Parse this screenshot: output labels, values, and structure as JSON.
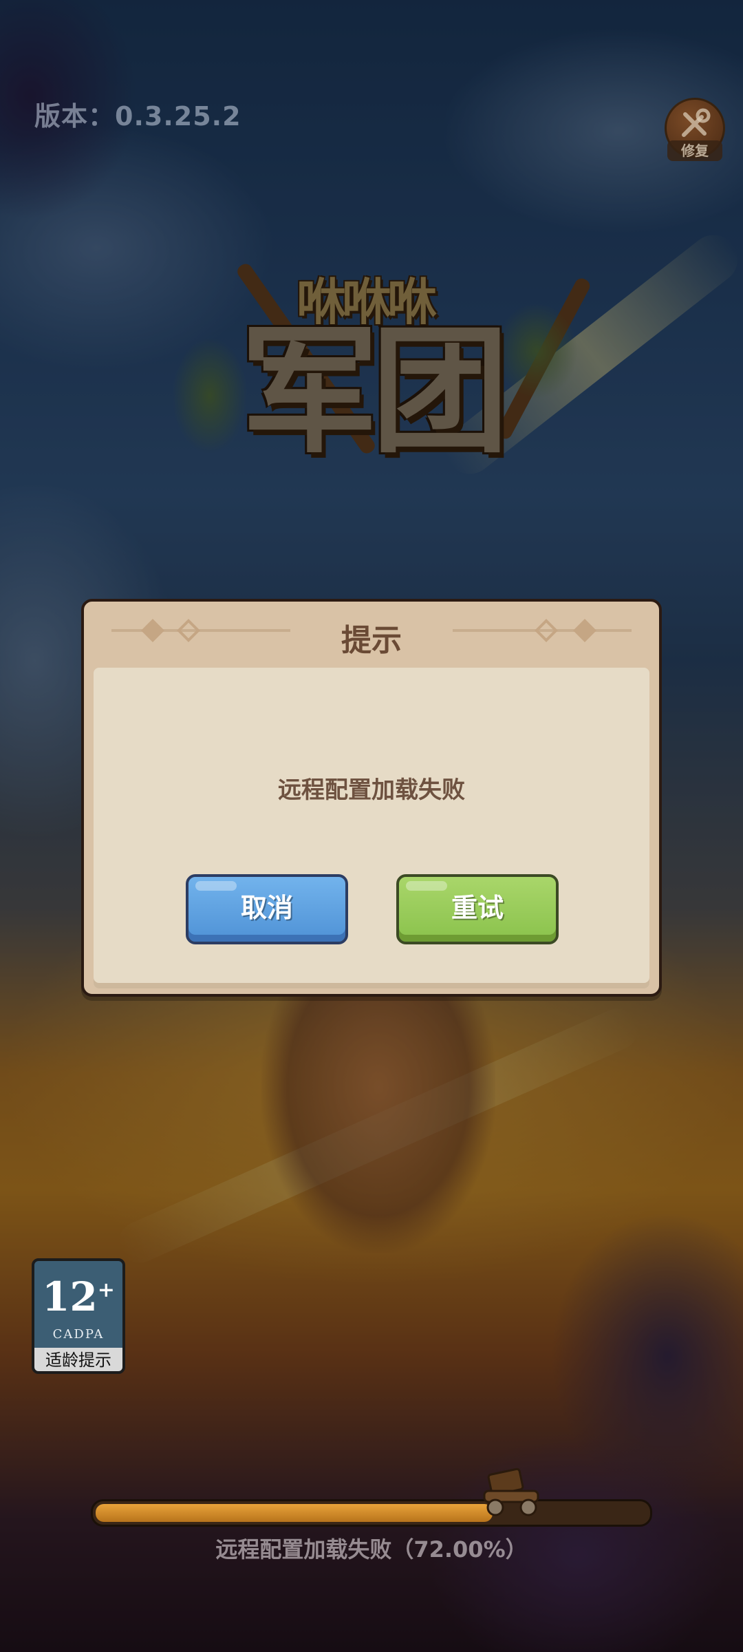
{
  "version_text": "版本：0.3.25.2",
  "repair": {
    "label": "修复",
    "icon": "wrench-screwdriver-icon"
  },
  "logo": {
    "top_text": "咻咻咻",
    "main_text": "军团"
  },
  "dialog": {
    "title": "提示",
    "message": "远程配置加载失败",
    "cancel_label": "取消",
    "retry_label": "重试"
  },
  "age_rating": {
    "number": "12",
    "plus": "+",
    "org": "CADPA",
    "tip": "适龄提示"
  },
  "progress": {
    "fraction": 0.72,
    "text": "远程配置加载失败（72.00%）"
  },
  "colors": {
    "cancel_button": "#5a9fe0",
    "retry_button": "#98cb58",
    "dialog_frame": "#d9c2a6",
    "dialog_body": "#e6dbc6",
    "title_text": "#6a4a35",
    "progress_fill": "#d48d2c"
  }
}
